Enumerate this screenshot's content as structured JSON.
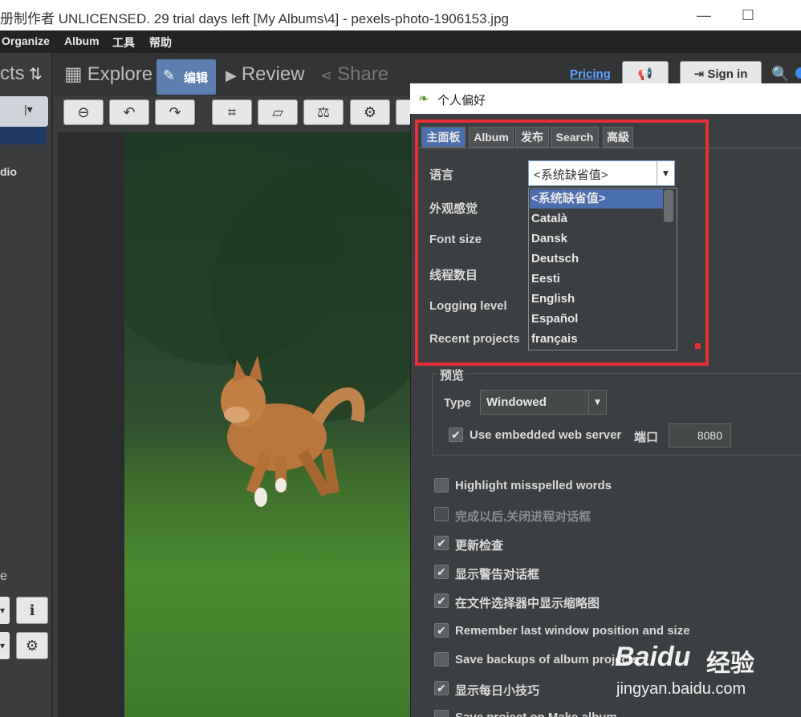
{
  "window": {
    "title": "册制作者 UNLICENSED. 29 trial days left [My Albums\\4] - pexels-photo-1906153.jpg",
    "min_symbol": "—",
    "max_symbol": "☐"
  },
  "menubar": [
    "Organize",
    "Album",
    "工具",
    "帮助"
  ],
  "left_panel": {
    "header": "cts",
    "item_label": "dio",
    "footer_letter": "e"
  },
  "nav_tabs": [
    {
      "label": "Explore",
      "icon": "grid-icon"
    },
    {
      "label": "编辑",
      "icon": "pencil-icon"
    },
    {
      "label": "Review",
      "icon": "play-icon"
    },
    {
      "label": "Share",
      "icon": "share-icon"
    }
  ],
  "top_right": {
    "pricing": "Pricing",
    "sign_in": "Sign in"
  },
  "dialog": {
    "title": "个人偏好",
    "tabs": [
      "主面板",
      "Album",
      "发布",
      "Search",
      "高級"
    ],
    "fields": {
      "language_label": "语言",
      "lookandfeel_label": "外观感觉",
      "fontsize_label": "Font size",
      "threads_label": "线程数目",
      "logging_label": "Logging level",
      "recent_label": "Recent projects"
    },
    "language": {
      "value": "<系统缺省值>",
      "options": [
        "<系统缺省值>",
        "Català",
        "Dansk",
        "Deutsch",
        "Eesti",
        "English",
        "Español",
        "français"
      ],
      "selected_index": 0
    },
    "preview": {
      "title": "预览",
      "type_label": "Type",
      "type_value": "Windowed",
      "embedded_label": "Use embedded web server",
      "embedded_checked": true,
      "port_label": "端口",
      "port_value": "8080"
    },
    "checkboxes": [
      {
        "label": "Highlight misspelled words",
        "checked": false,
        "enabled": true
      },
      {
        "label": "完成以后,关闭进程对话框",
        "checked": false,
        "enabled": false
      },
      {
        "label": "更新检查",
        "checked": true,
        "enabled": true
      },
      {
        "label": "显示警告对话框",
        "checked": true,
        "enabled": true
      },
      {
        "label": "在文件选择器中显示缩略图",
        "checked": true,
        "enabled": true
      },
      {
        "label": "Remember last window position and size",
        "checked": true,
        "enabled": true
      },
      {
        "label": "Save backups of album projects",
        "checked": false,
        "enabled": true
      },
      {
        "label": "显示每日小技巧",
        "checked": true,
        "enabled": true
      },
      {
        "label": "Save project on Make album",
        "checked": false,
        "enabled": true
      }
    ]
  },
  "watermark": {
    "brand": "Baidu",
    "cn": "经验",
    "url": "jingyan.baidu.com"
  },
  "check_mark": "✔"
}
